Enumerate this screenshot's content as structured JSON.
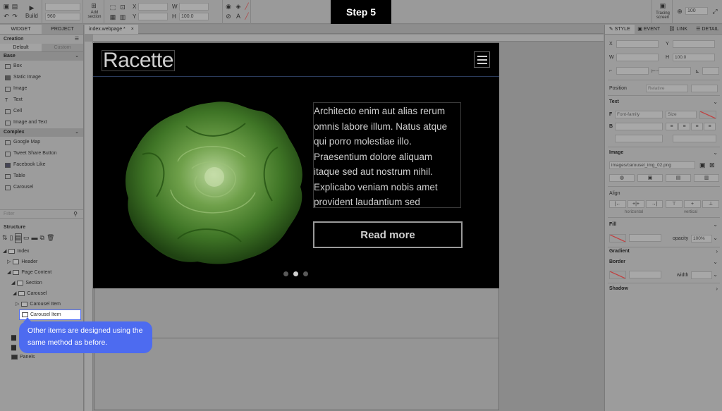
{
  "toolbar": {
    "build_label": "Build",
    "zoom_field": "960",
    "add_section_label": "Add section",
    "x_label": "X",
    "y_label": "Y",
    "w_label": "W",
    "h_label": "H",
    "h_value": "100.0",
    "tracing_label": "Tracing screen",
    "zoom_value": "100"
  },
  "step_badge": "Step 5",
  "left_panel": {
    "tabs": [
      "WIDGET",
      "PROJECT"
    ],
    "creation_title": "Creation",
    "subtabs": [
      "Default",
      "Custom"
    ],
    "base_title": "Base",
    "base_items": [
      "Box",
      "Static Image",
      "Image",
      "Text",
      "Cell",
      "Image and Text"
    ],
    "complex_title": "Complex",
    "complex_items": [
      "Google Map",
      "Tweet Share Button",
      "Facebook Like",
      "Table",
      "Carousel"
    ],
    "filter_placeholder": "Filter",
    "structure_title": "Structure",
    "tree": [
      {
        "label": "Index",
        "indent": 0
      },
      {
        "label": "Header",
        "indent": 1
      },
      {
        "label": "Page Content",
        "indent": 1
      },
      {
        "label": "Section",
        "indent": 2
      },
      {
        "label": "Carousel",
        "indent": 3
      },
      {
        "label": "Carousel Item",
        "indent": 4
      }
    ],
    "selected_item": "Carousel Item",
    "panels_label": "Panels"
  },
  "doc_tab": "index.webpage *",
  "carousel": {
    "logo": "Racette",
    "body_text": "Architecto enim aut alias rerum omnis labore illum. Natus atque qui porro molestiae illo. Praesentium dolore aliquam itaque sed aut nostrum nihil. Explicabo veniam nobis amet provident laudantium sed",
    "button_label": "Read more"
  },
  "right_panel": {
    "tabs": [
      "STYLE",
      "EVENT",
      "LINK",
      "DETAIL"
    ],
    "x_label": "X",
    "y_label": "Y",
    "w_label": "W",
    "h_label": "H",
    "h_value": "100.0",
    "position_label": "Position",
    "position_value": "Relative",
    "text_title": "Text",
    "font_family": "Font-family",
    "size_label": "Size",
    "image_title": "Image",
    "image_path": "images/carousel_img_02.png",
    "align_title": "Align",
    "horizontal_label": "horizontal",
    "vertical_label": "vertical",
    "fill_title": "Fill",
    "opacity_label": "opacity",
    "opacity_value": "100%",
    "gradient_title": "Gradient",
    "border_title": "Border",
    "width_label": "width",
    "shadow_title": "Shadow"
  },
  "tooltip": "Other items are designed using the same method as before."
}
